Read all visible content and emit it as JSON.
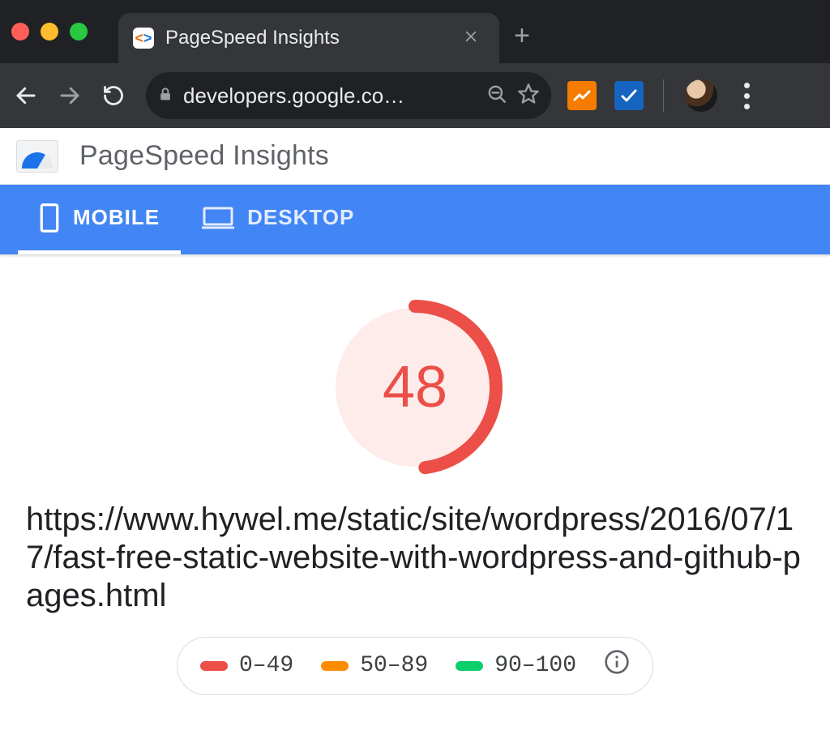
{
  "browser": {
    "tab_title": "PageSpeed Insights",
    "url_text": "developers.google.co…"
  },
  "page": {
    "app_title": "PageSpeed Insights",
    "tabs": {
      "mobile": "MOBILE",
      "desktop": "DESKTOP"
    },
    "tested_url": "https://www.hywel.me/static/site/wordpress/2016/07/17/fast-free-static-website-with-wordpress-and-github-pages.html",
    "score": 48,
    "score_color": "#eb4f47",
    "gauge_bg_color": "#fdecea",
    "legend": {
      "r1": "0–49",
      "r2": "50–89",
      "r3": "90–100",
      "c1": "#eb4f47",
      "c2": "#fb8c00",
      "c3": "#0cce6b"
    }
  }
}
